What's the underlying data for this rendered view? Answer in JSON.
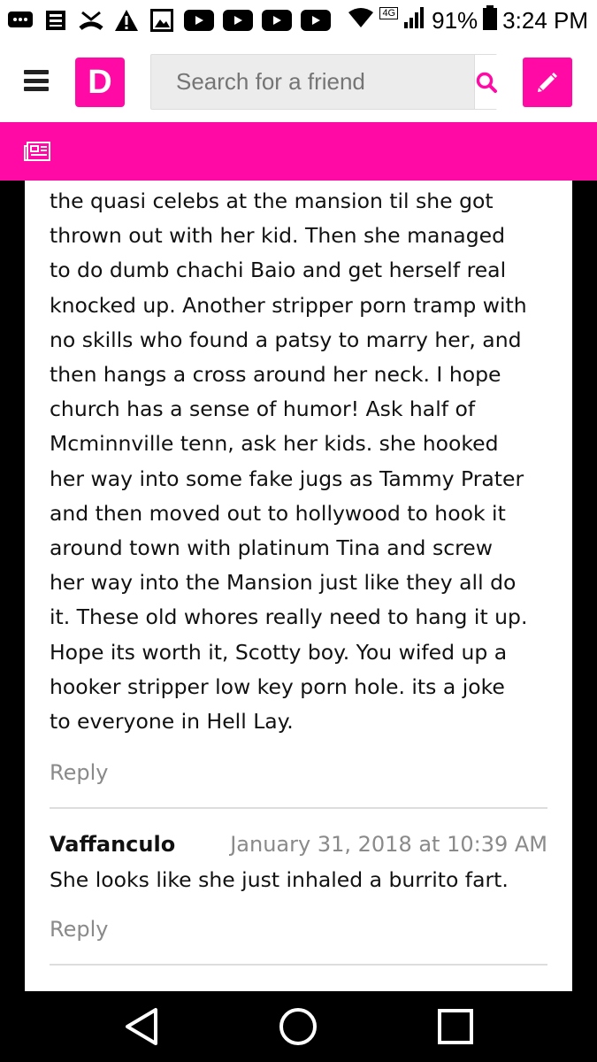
{
  "status_bar": {
    "battery": "91%",
    "time": "3:24 PM",
    "network": "4G",
    "icons": [
      "chat-icon",
      "news-icon",
      "missed-call-icon",
      "warning-icon",
      "image-icon",
      "youtube-icon",
      "youtube-icon",
      "youtube-icon",
      "youtube-icon",
      "wifi-icon",
      "signal-icon",
      "battery-icon"
    ]
  },
  "header": {
    "logo_letter": "D",
    "search_placeholder": "Search for a friend"
  },
  "comment_main": {
    "lines": [
      "the quasi celebs at the mansion til she got",
      "thrown out with her kid. Then she managed",
      "to do dumb chachi Baio and get herself real",
      "knocked up. Another stripper porn tramp with",
      "no skills who found a patsy to marry her, and",
      "then hangs a cross around her neck. I hope",
      "church has a sense of humor! Ask half of",
      "Mcminnville tenn, ask her kids. she hooked",
      "her way into some fake jugs as Tammy Prater",
      "and then moved out to hollywood to hook it",
      "around town with platinum Tina and screw",
      "her way into the Mansion just like they all do",
      "it. These old whores really need to hang it up.",
      "Hope its worth it, Scotty boy. You wifed up a",
      "hooker stripper low key porn hole. its a joke",
      "to everyone in Hell Lay."
    ],
    "reply_label": "Reply"
  },
  "comment_second": {
    "author": "Vaffanculo",
    "date": "January 31, 2018 at 10:39 AM",
    "text": "She looks like she just inhaled a burrito fart.",
    "reply_label": "Reply"
  },
  "colors": {
    "brand_pink": "#ff0aa4"
  }
}
